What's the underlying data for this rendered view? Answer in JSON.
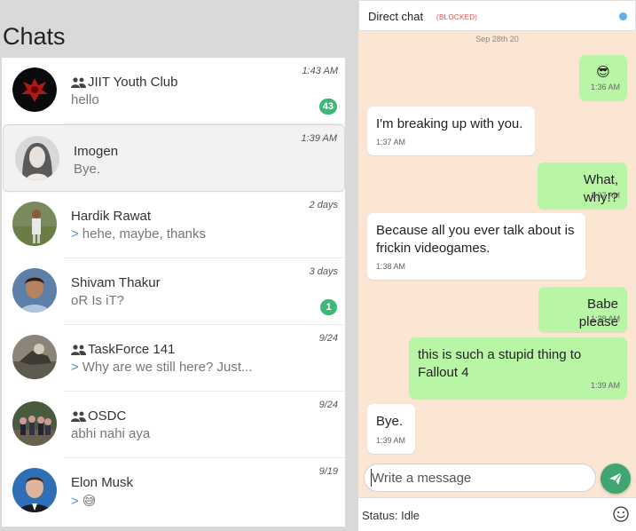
{
  "left": {
    "title": "Chats",
    "chats": [
      {
        "name": "JIIT Youth Club",
        "group": true,
        "message": "hello",
        "sent_by_me": false,
        "time": "1:43 AM",
        "unread": "43"
      },
      {
        "name": "Imogen",
        "group": false,
        "message": "Bye.",
        "sent_by_me": false,
        "time": "1:39 AM",
        "unread": ""
      },
      {
        "name": "Hardik Rawat",
        "group": false,
        "message": "hehe, maybe, thanks",
        "sent_by_me": true,
        "time": "2 days",
        "unread": ""
      },
      {
        "name": "Shivam Thakur",
        "group": false,
        "message": "oR Is iT?",
        "sent_by_me": false,
        "time": "3 days",
        "unread": "1"
      },
      {
        "name": "TaskForce 141",
        "group": true,
        "message": "Why are we still here? Just...",
        "sent_by_me": true,
        "time": "9/24",
        "unread": ""
      },
      {
        "name": "OSDC",
        "group": true,
        "message": "abhi nahi aya",
        "sent_by_me": false,
        "time": "9/24",
        "unread": ""
      },
      {
        "name": "Elon Musk",
        "group": false,
        "message": "😅",
        "sent_by_me": true,
        "time": "9/19",
        "unread": ""
      }
    ],
    "sent_arrow": ">"
  },
  "chat": {
    "title": "Direct chat",
    "blocked_label": "(BLOCKED)",
    "date": "Sep 28th 20",
    "messages": [
      {
        "text": "😎",
        "time": "1:36 AM",
        "dir": "out"
      },
      {
        "text": "I'm breaking up with you.",
        "time": "1:37 AM",
        "dir": "in"
      },
      {
        "text": "What, why!?",
        "time": "1:37 AM",
        "dir": "out"
      },
      {
        "text": "Because all you ever talk about is frickin videogames.",
        "time": "1:38 AM",
        "dir": "in"
      },
      {
        "text": "Babe please",
        "time": "1:38 AM",
        "dir": "out"
      },
      {
        "text": "this is such a stupid thing to Fallout 4",
        "time": "1:39 AM",
        "dir": "out"
      },
      {
        "text": "Bye.",
        "time": "1:39 AM",
        "dir": "in"
      }
    ],
    "input_placeholder": "Write a message",
    "status": "Status: Idle"
  },
  "colors": {
    "accent": "#3cb878",
    "outgoing": "#b8f6a6",
    "chat_bg": "#fbe5d3",
    "blocked": "#d9534f"
  }
}
